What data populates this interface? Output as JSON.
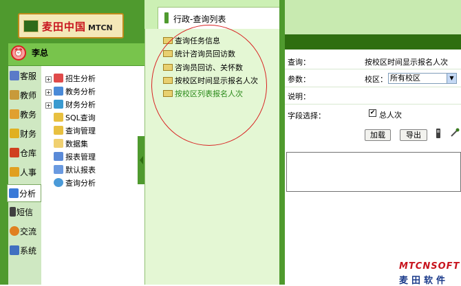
{
  "logo": {
    "brand_cn": "麦田中国",
    "brand_en": "MTCN"
  },
  "user": {
    "name": "李总"
  },
  "tabs": [
    {
      "label": "客服",
      "icon": "book-icon",
      "color": "#5a7ac8"
    },
    {
      "label": "教师",
      "icon": "teacher-icon",
      "color": "#c89a3a"
    },
    {
      "label": "教务",
      "icon": "academic-icon",
      "color": "#e0a030"
    },
    {
      "label": "财务",
      "icon": "finance-icon",
      "color": "#e0b020"
    },
    {
      "label": "仓库",
      "icon": "warehouse-icon",
      "color": "#d04020"
    },
    {
      "label": "人事",
      "icon": "personnel-icon",
      "color": "#e0a020"
    },
    {
      "label": "分析",
      "icon": "analysis-icon",
      "color": "#3a7ad8"
    },
    {
      "label": "短信",
      "icon": "phone-icon",
      "color": "#404040"
    },
    {
      "label": "交流",
      "icon": "chat-icon",
      "color": "#e08020"
    },
    {
      "label": "系统",
      "icon": "system-icon",
      "color": "#4070c0"
    }
  ],
  "tree": [
    {
      "label": "招生分析",
      "expander": "+",
      "icon": "recruit-icon"
    },
    {
      "label": "教务分析",
      "expander": "+",
      "icon": "academic-analysis-icon"
    },
    {
      "label": "财务分析",
      "expander": "+",
      "icon": "finance-analysis-icon"
    },
    {
      "label": "SQL查询",
      "expander": "",
      "icon": "sql-icon"
    },
    {
      "label": "查询管理",
      "expander": "",
      "icon": "query-manage-icon"
    },
    {
      "label": "数据集",
      "expander": "",
      "icon": "dataset-icon"
    },
    {
      "label": "报表管理",
      "expander": "",
      "icon": "report-manage-icon"
    },
    {
      "label": "默认报表",
      "expander": "",
      "icon": "default-report-icon"
    },
    {
      "label": "查询分析",
      "expander": "",
      "icon": "query-analysis-icon"
    }
  ],
  "middle": {
    "title": "行政-查询列表",
    "items": [
      {
        "label": "查询任务信息"
      },
      {
        "label": "统计咨询员回访数"
      },
      {
        "label": "咨询员回访、关怀数"
      },
      {
        "label": "按校区时间显示报名人次"
      },
      {
        "label": "按校区列表报名人次"
      }
    ]
  },
  "form": {
    "query_label": "查询：",
    "query_value": "按校区时间显示报名人次",
    "param_label": "参数：",
    "campus_label": "校区：",
    "campus_selected": "所有校区",
    "desc_label": "说明：",
    "field_label": "字段选择：",
    "field_option": "总人次",
    "field_checked": "✔",
    "load_button": "加载",
    "export_button": "导出"
  },
  "watermark": {
    "line1": "MTCNSOFT",
    "line2": "麦田软件"
  },
  "colors": {
    "sidebar_green": "#4f9a2e",
    "panel_green": "#ccf0b4",
    "highlight_circle": "#d82020",
    "active_item": "#2a8a1a"
  }
}
